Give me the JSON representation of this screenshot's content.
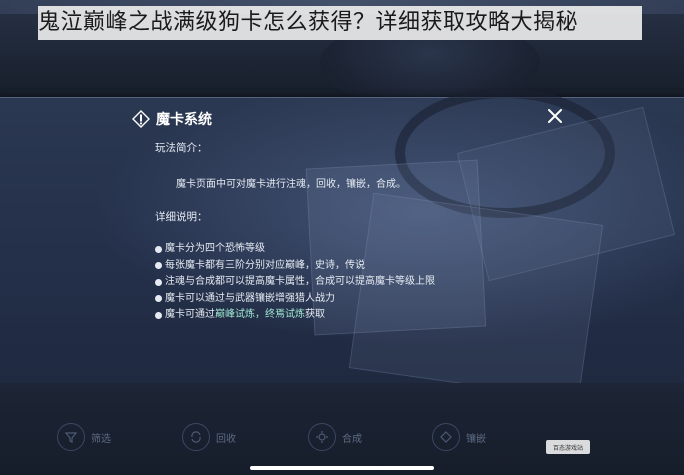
{
  "banner": {
    "title": "鬼泣巅峰之战满级狗卡怎么获得？详细获取攻略大揭秘"
  },
  "modal": {
    "title": "魔卡系统",
    "intro_heading": "玩法简介：",
    "intro_text": "魔卡页面中可对魔卡进行注魂，回收，镶嵌，合成。",
    "detail_heading": "详细说明：",
    "details": [
      {
        "text": "魔卡分为四个恐怖等级"
      },
      {
        "text": "每张魔卡都有三阶分别对应巅峰，史诗，传说"
      },
      {
        "text": "注魂与合成都可以提高魔卡属性，合成可以提高魔卡等级上限"
      },
      {
        "text": "魔卡可以通过与武器镶嵌增强猎人战力"
      },
      {
        "prefix": "魔卡可通过",
        "highlight": "巅峰试炼，终焉试炼",
        "suffix": "获取"
      }
    ]
  },
  "bottom_bar": {
    "buttons": [
      {
        "label": "筛选",
        "icon": "filter-icon"
      },
      {
        "label": "回收",
        "icon": "recycle-icon"
      },
      {
        "label": "合成",
        "icon": "merge-icon"
      },
      {
        "label": "镶嵌",
        "icon": "inlay-icon"
      }
    ]
  },
  "watermark": {
    "text": "百态游戏站"
  },
  "colors": {
    "highlight": "#9fe6d0",
    "modal_bg": "#26334d",
    "text": "#e6ebf3"
  }
}
